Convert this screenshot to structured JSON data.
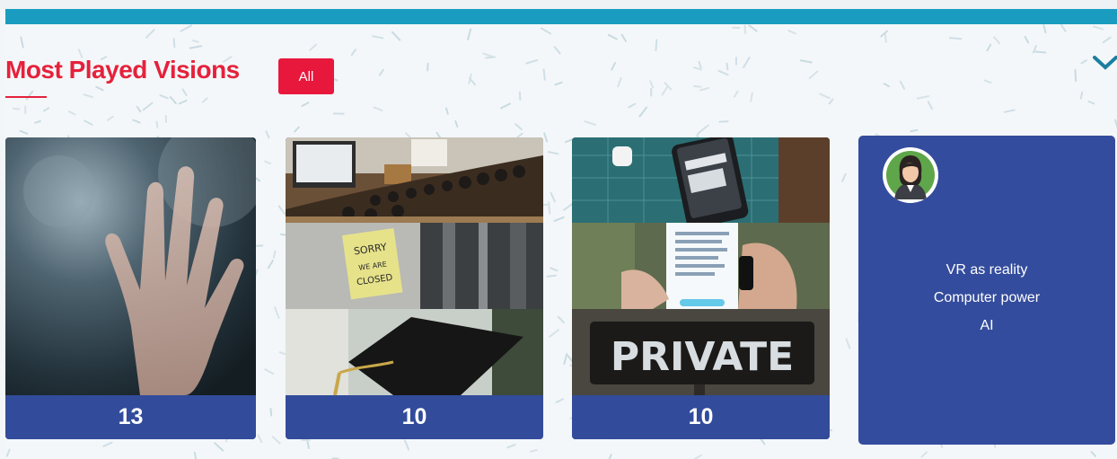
{
  "section": {
    "title": "Most Played Visions",
    "filter_label": "All"
  },
  "cards": [
    {
      "count": "13",
      "image": "hand-on-glass"
    },
    {
      "count": "10",
      "image": "collage-lecture-sorry-closed-graduation-cap"
    },
    {
      "count": "10",
      "image": "collage-phone-privacy-private-sign"
    }
  ],
  "profile_card": {
    "lines": [
      "VR as reality",
      "Computer power",
      "AI"
    ]
  },
  "icons": {
    "collapse": "chevron-down-icon",
    "avatar": "woman-avatar-icon"
  },
  "colors": {
    "accent_red": "#e5213b",
    "top_bar": "#1a9cc0",
    "card_blue": "#324c9b"
  }
}
